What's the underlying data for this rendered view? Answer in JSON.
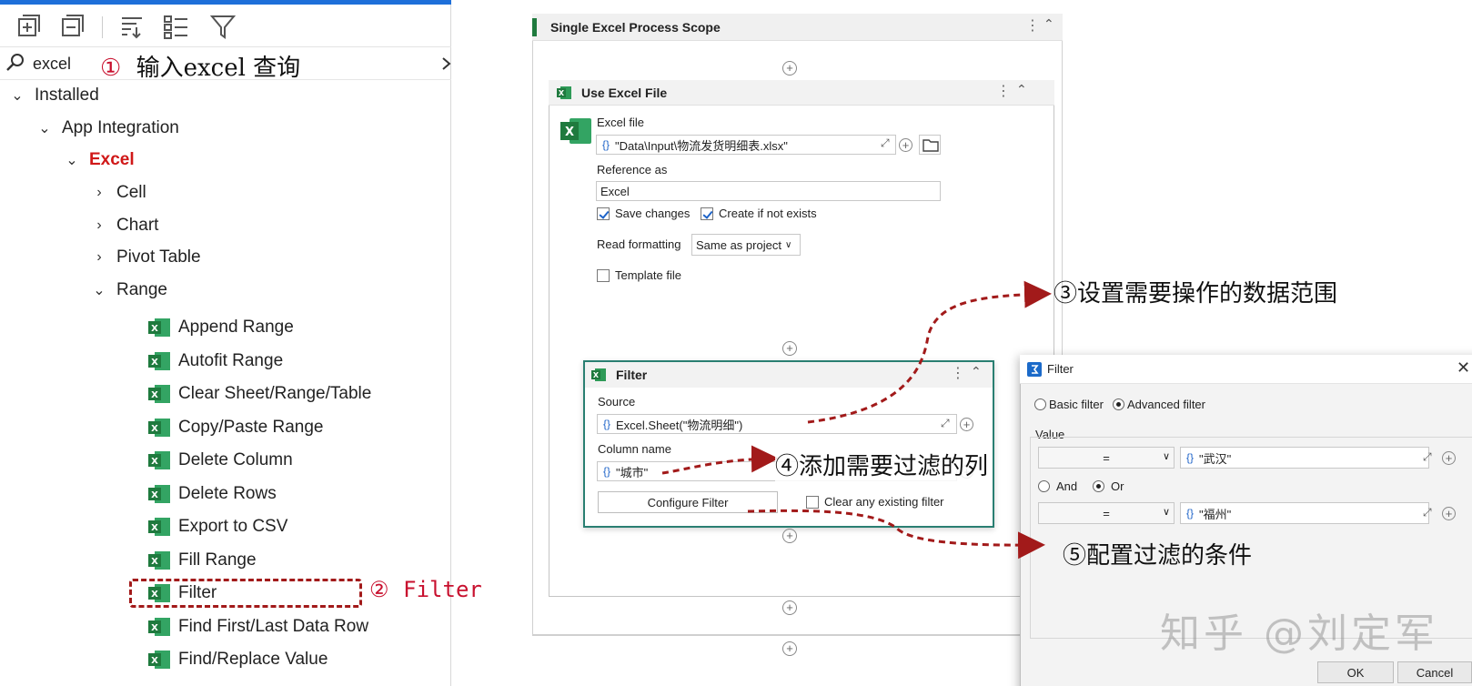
{
  "left_panel": {
    "search": {
      "value": "excel",
      "clear_icon": "chevron-right-icon"
    },
    "toolbar_icons": [
      "expand-all-icon",
      "collapse-all-icon",
      "sort-icon",
      "list-view-icon",
      "filter-icon"
    ],
    "tree": {
      "installed": "Installed",
      "app_integration": "App Integration",
      "excel": "Excel",
      "categories": [
        "Cell",
        "Chart",
        "Pivot Table",
        "Range"
      ],
      "range_items": [
        "Append Range",
        "Autofit Range",
        "Clear Sheet/Range/Table",
        "Copy/Paste Range",
        "Delete Column",
        "Delete Rows",
        "Export to CSV",
        "Fill Range",
        "Filter",
        "Find First/Last Data Row",
        "Find/Replace Value"
      ]
    }
  },
  "designer": {
    "scope_title": "Single Excel Process Scope",
    "use_excel": {
      "title": "Use Excel File",
      "excel_file_label": "Excel file",
      "excel_file_value": "\"Data\\Input\\物流发货明细表.xlsx\"",
      "reference_label": "Reference as",
      "reference_value": "Excel",
      "save_changes": "Save changes",
      "create_if_not_exists": "Create if not exists",
      "read_formatting_label": "Read formatting",
      "read_formatting_value": "Same as project",
      "template_file": "Template file"
    },
    "filter": {
      "title": "Filter",
      "source_label": "Source",
      "source_value": "Excel.Sheet(\"物流明细\")",
      "column_label": "Column name",
      "column_value": "\"城市\"",
      "configure_button": "Configure Filter",
      "clear_existing": "Clear any existing filter"
    }
  },
  "dialog": {
    "title": "Filter",
    "basic_filter": "Basic filter",
    "advanced_filter": "Advanced filter",
    "value_label": "Value",
    "op1": "=",
    "val1": "\"武汉\"",
    "and_label": "And",
    "or_label": "Or",
    "op2": "=",
    "val2": "\"福州\"",
    "ok": "OK",
    "cancel": "Cancel"
  },
  "annotations": {
    "a1_num": "①",
    "a1_text": "输入excel 查询",
    "a2_num": "②",
    "a2_text": "Filter",
    "a3": "③设置需要操作的数据范围",
    "a4": "④添加需要过滤的列",
    "a5": "⑤配置过滤的条件"
  },
  "watermark": "知乎 @刘定军",
  "colors": {
    "annotation_red": "#c8102e",
    "excel_green": "#1f7a3e",
    "link_blue": "#1d63c8",
    "filter_border": "#2a7f72"
  }
}
